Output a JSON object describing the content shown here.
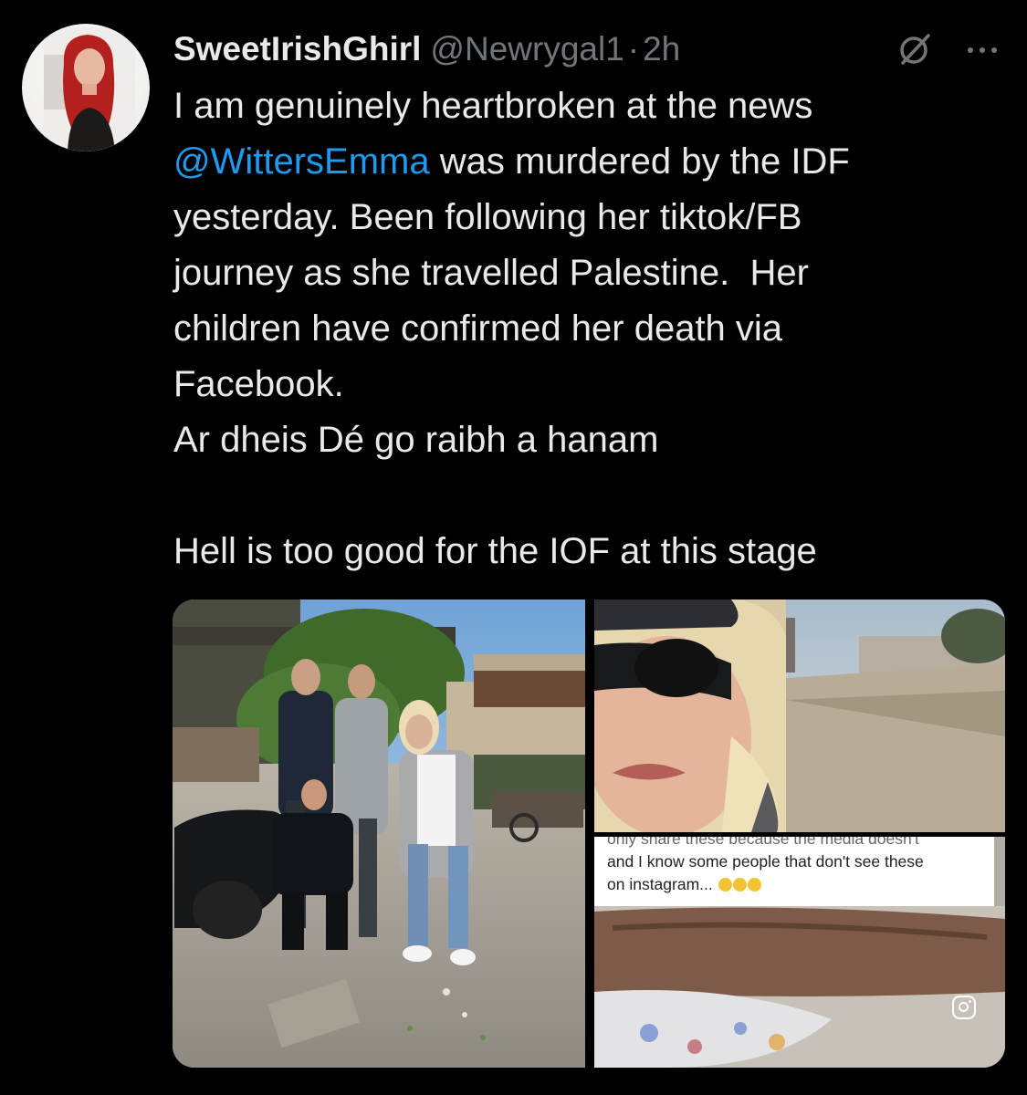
{
  "tweet": {
    "display_name": "SweetIrishGhirl",
    "handle": "@Newrygal1",
    "separator": "·",
    "time": "2h",
    "text_line1": "I am genuinely heartbroken at the news",
    "mention": "@WittersEmma",
    "text_line2_rest": " was murdered by the IDF",
    "text_rest": "yesterday. Been following her tiktok/FB\njourney as she travelled Palestine.  Her\nchildren have confirmed her death via\nFacebook.\nAr dheis Dé go raibh a hanam\n\nHell is too good for the IOF at this stage"
  },
  "media": {
    "caption_top_cut": "only share these because the media doesn't",
    "caption_line1": "and I know some people that don't see these",
    "caption_line2": "on instagram..."
  },
  "icons": {
    "grok": "grok-icon",
    "more": "more-icon",
    "instagram": "instagram-icon"
  },
  "colors": {
    "background": "#000000",
    "text": "#e7e9ea",
    "muted": "#71767b",
    "link": "#1d9bf0"
  }
}
